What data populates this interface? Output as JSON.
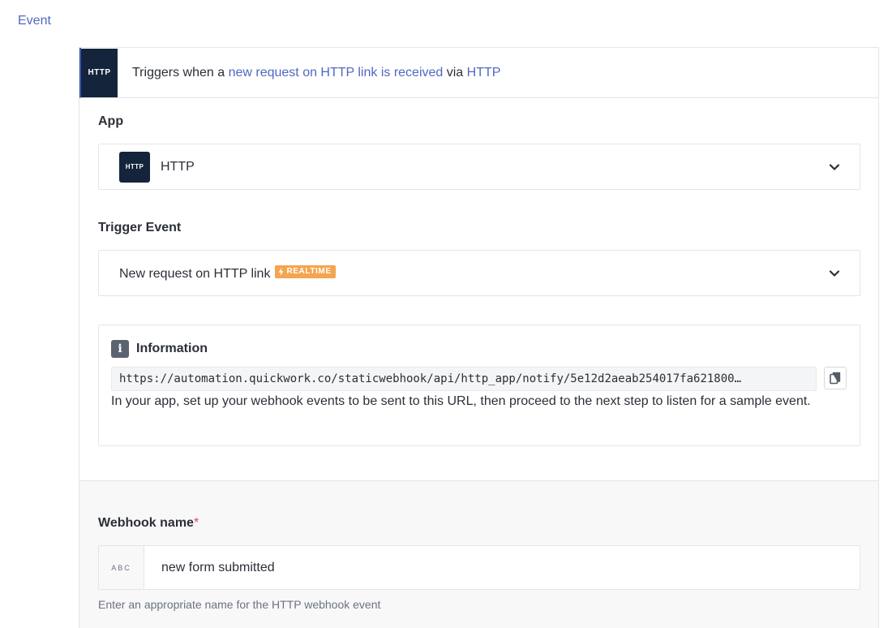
{
  "section": {
    "label": "Event"
  },
  "summary": {
    "logo_text": "HTTP",
    "prefix": "Triggers when a ",
    "trigger_link": "new request on HTTP link is received",
    "middle": " via ",
    "app_link": "HTTP"
  },
  "app_field": {
    "label": "App",
    "logo_text": "HTTP",
    "value": "HTTP",
    "icon": "chevron-down-icon"
  },
  "trigger_field": {
    "label": "Trigger Event",
    "value": "New request on HTTP link",
    "badge": "REALTIME",
    "badge_color": "#f5a44f",
    "icon": "chevron-down-icon"
  },
  "information": {
    "icon_glyph": "i",
    "title": "Information",
    "url": "https://automation.quickwork.co/staticwebhook/api/http_app/notify/5e12d2aeab254017fa621800…",
    "description": "In your app, set up your webhook events to be sent to this URL, then proceed to the next step to listen for a sample event.",
    "copy_icon": "copy-icon"
  },
  "webhook_field": {
    "label": "Webhook name",
    "required_mark": "*",
    "type_tag": "ABC",
    "value": "new form submitted",
    "help": "Enter an appropriate name for the HTTP webhook event"
  },
  "colors": {
    "accent": "#5068c2",
    "logo_bg": "#14243a",
    "required": "#e0475a"
  }
}
